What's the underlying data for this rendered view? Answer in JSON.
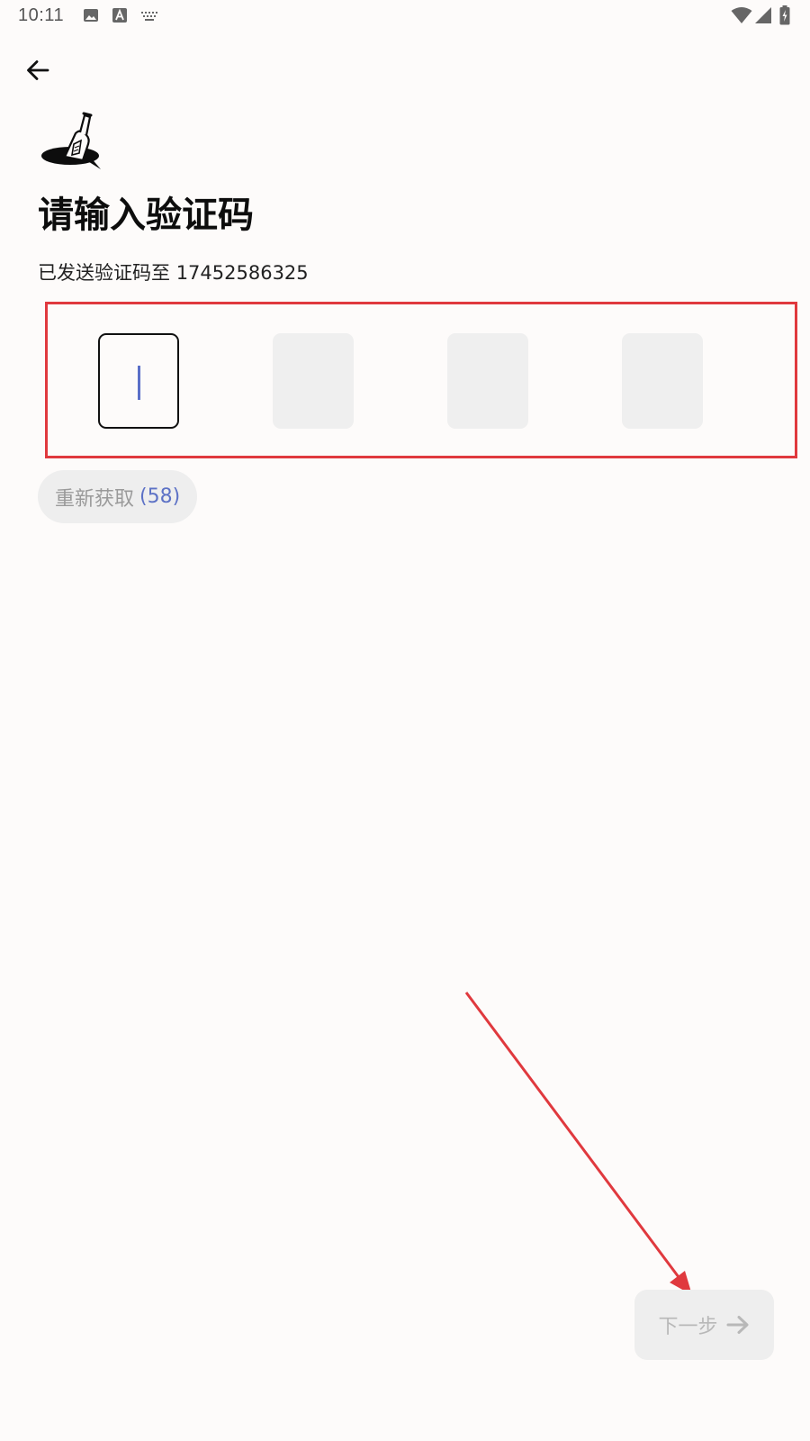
{
  "status_bar": {
    "time": "10:11",
    "left_icons": [
      "image-icon",
      "text-a-icon",
      "keyboard-icon"
    ],
    "right_icons": [
      "wifi-icon",
      "signal-icon",
      "battery-charging-icon"
    ]
  },
  "header": {
    "back_icon": "arrow-left-icon"
  },
  "logo": {
    "icon": "bottle-in-hole-logo"
  },
  "title": "请输入验证码",
  "sent_prefix": "已发送验证码至",
  "phone": "17452586325",
  "code_inputs": [
    {
      "value": "",
      "state": "active"
    },
    {
      "value": "",
      "state": "empty"
    },
    {
      "value": "",
      "state": "empty"
    },
    {
      "value": "",
      "state": "empty"
    }
  ],
  "resend": {
    "label": "重新获取",
    "countdown": "(58)"
  },
  "next": {
    "label": "下一步",
    "icon": "arrow-right-icon",
    "enabled": false
  },
  "colors": {
    "background": "#fdfbfa",
    "highlight_border": "#e0393e",
    "cursor": "#5a6fc8",
    "countdown": "#5d72c6",
    "disabled_text": "#b8b8b8"
  }
}
